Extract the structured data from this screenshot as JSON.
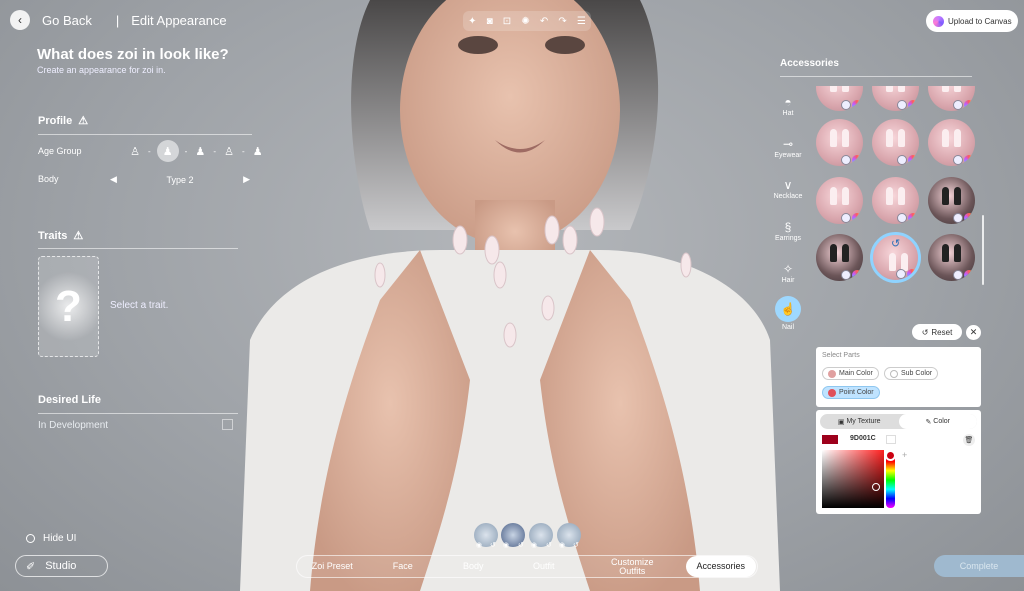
{
  "header": {
    "back_label": "Go Back",
    "separator": "|",
    "section_title": "Edit Appearance"
  },
  "page": {
    "title": "What does zoi in look like?",
    "subtitle": "Create an appearance for zoi in."
  },
  "profile": {
    "heading": "Profile",
    "age_label": "Age Group",
    "age_groups": [
      "child",
      "teen",
      "young-adult",
      "adult",
      "elder"
    ],
    "age_selected_index": 1,
    "body_label": "Body",
    "body_value": "Type 2"
  },
  "traits": {
    "heading": "Traits",
    "placeholder_glyph": "?",
    "select_label": "Select a trait."
  },
  "desired_life": {
    "heading": "Desired Life",
    "value": "In Development"
  },
  "toolbar": {
    "icons": [
      "sparkle-icon",
      "camera-icon",
      "focus-icon",
      "pose-icon",
      "undo-icon",
      "redo-icon",
      "menu-icon"
    ]
  },
  "upload": {
    "label": "Upload to Canvas"
  },
  "accessories": {
    "title": "Accessories",
    "categories": [
      {
        "label": "Hat",
        "icon": "hat-icon"
      },
      {
        "label": "Eyewear",
        "icon": "eyewear-icon"
      },
      {
        "label": "Necklace",
        "icon": "necklace-icon"
      },
      {
        "label": "Earrings",
        "icon": "earrings-icon"
      },
      {
        "label": "Hair",
        "icon": "hair-clip-icon"
      },
      {
        "label": "Nail",
        "icon": "nail-icon"
      }
    ],
    "active_category": "Nail"
  },
  "reset": {
    "label": "Reset",
    "close_glyph": "✕"
  },
  "parts": {
    "label": "Select Parts",
    "options": [
      {
        "label": "Main Color",
        "color": "#e0a0a0"
      },
      {
        "label": "Sub Color",
        "color": "#ffffff"
      },
      {
        "label": "Point Color",
        "color": "#e0505a"
      }
    ],
    "selected": "Point Color"
  },
  "color_panel": {
    "tabs": [
      "My Texture",
      "Color"
    ],
    "active_tab": "Color",
    "hex": "9D001C",
    "swatch": "#9D001C"
  },
  "bottom": {
    "hide_ui": "Hide UI",
    "studio": "Studio",
    "nav": [
      "Zoi Preset",
      "Face",
      "Body",
      "Outfit",
      "Customize Outfits",
      "Accessories"
    ],
    "active_nav": "Accessories",
    "complete": "Complete"
  }
}
